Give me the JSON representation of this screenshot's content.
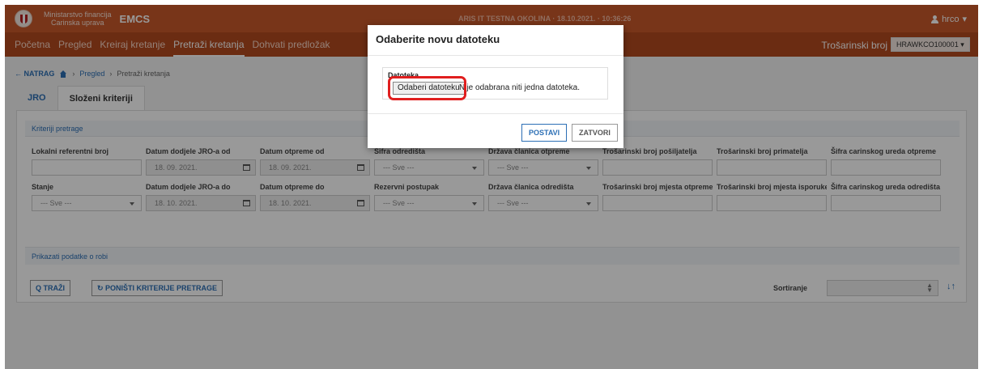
{
  "header": {
    "ministry_line1": "Ministarstvo financija",
    "ministry_line2": "Carinska uprava",
    "app_name": "EMCS",
    "environment": "ARIS IT TESTNA OKOLINA · 18.10.2021. · 10:36:26",
    "user": "hrco"
  },
  "nav": {
    "items": [
      "Početna",
      "Pregled",
      "Kreiraj kretanje",
      "Pretraži kretanja",
      "Dohvati predložak"
    ],
    "active_index": 3,
    "tax_label": "Trošarinski broj",
    "tax_value": "HRAWKCO100001"
  },
  "breadcrumb": {
    "back": "← NATRAG",
    "link": "Pregled",
    "current": "Pretraži kretanja"
  },
  "tabs": [
    "JRO",
    "Složeni kriteriji"
  ],
  "criteria": {
    "section_title": "Kriteriji pretrage",
    "row1": [
      {
        "label": "Lokalni referentni broj",
        "value": "",
        "type": "text"
      },
      {
        "label": "Datum dodjele JRO-a od",
        "value": "18. 09. 2021.",
        "type": "date"
      },
      {
        "label": "Datum otpreme od",
        "value": "18. 09. 2021.",
        "type": "date"
      },
      {
        "label": "Šifra odredišta",
        "value": "--- Sve ---",
        "type": "select"
      },
      {
        "label": "Država članica otpreme",
        "value": "--- Sve ---",
        "type": "select"
      },
      {
        "label": "Trošarinski broj pošiljatelja",
        "value": "",
        "type": "text"
      },
      {
        "label": "Trošarinski broj primatelja",
        "value": "",
        "type": "text"
      },
      {
        "label": "Šifra carinskog ureda otpreme",
        "value": "",
        "type": "text"
      }
    ],
    "row2": [
      {
        "label": "Stanje",
        "value": "--- Sve ---",
        "type": "select"
      },
      {
        "label": "Datum dodjele JRO-a do",
        "value": "18. 10. 2021.",
        "type": "date"
      },
      {
        "label": "Datum otpreme do",
        "value": "18. 10. 2021.",
        "type": "date"
      },
      {
        "label": "Rezervni postupak",
        "value": "--- Sve ---",
        "type": "select"
      },
      {
        "label": "Država članica odredišta",
        "value": "--- Sve ---",
        "type": "select"
      },
      {
        "label": "Trošarinski broj mjesta otpreme",
        "value": "",
        "type": "text"
      },
      {
        "label": "Trošarinski broj mjesta isporuke",
        "value": "",
        "type": "text"
      },
      {
        "label": "Šifra carinskog ureda odredišta",
        "value": "",
        "type": "text"
      }
    ],
    "goods_link": "Prikazati podatke o robi"
  },
  "actions": {
    "search": "Q TRAŽI",
    "reset": "↻ PONIŠTI KRITERIJE PRETRAGE",
    "sort_label": "Sortiranje",
    "sort_toggle": "↓↑"
  },
  "modal": {
    "title": "Odaberite novu datoteku",
    "field_label": "Datoteka",
    "choose_button": "Odaberi datoteku",
    "file_status": "Nije odabrana niti jedna datoteka.",
    "apply": "POSTAVI",
    "close": "ZATVORI"
  }
}
